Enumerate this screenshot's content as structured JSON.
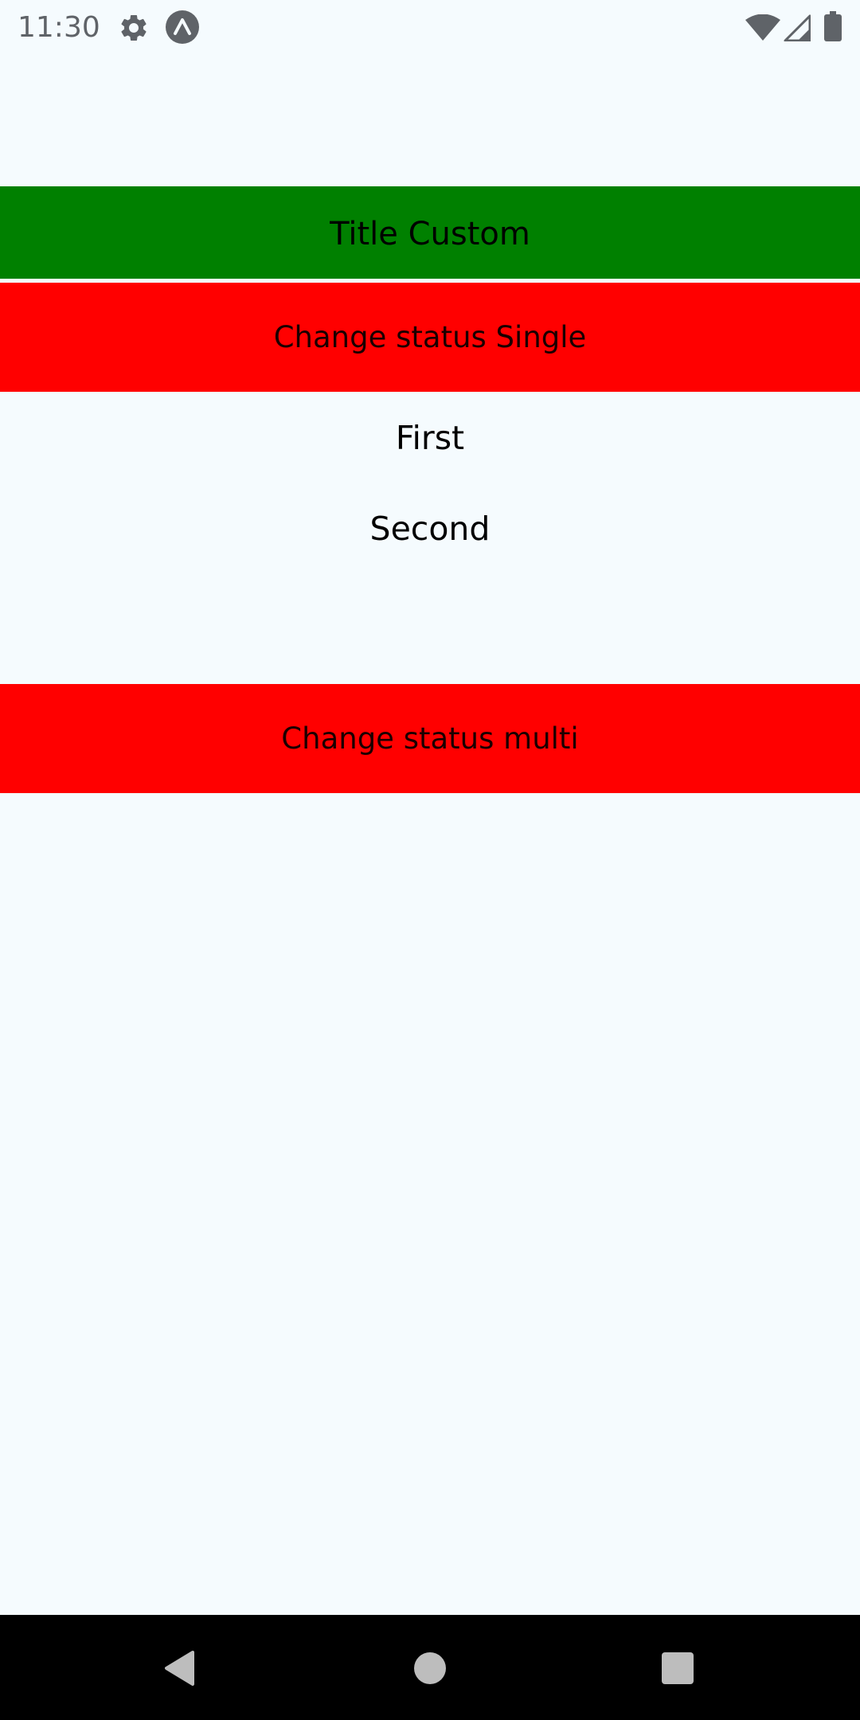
{
  "status_bar": {
    "time": "11:30",
    "icons": [
      "gear-icon",
      "expo-icon",
      "wifi-icon",
      "signal-icon",
      "battery-icon"
    ]
  },
  "header": {
    "title": "Title Custom",
    "color": "#008000"
  },
  "buttons": {
    "single_label": "Change status Single",
    "multi_label": "Change status multi",
    "color": "#FF0000"
  },
  "list": {
    "items": [
      "First",
      "Second"
    ]
  },
  "nav_bar": {
    "icons": [
      "back-icon",
      "home-icon",
      "recents-icon"
    ]
  },
  "colors": {
    "background": "#F5FBFE",
    "nav_background": "#000000"
  }
}
